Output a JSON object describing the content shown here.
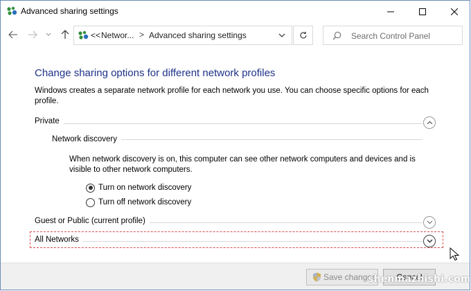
{
  "window": {
    "title": "Advanced sharing settings",
    "icon": "network-sharing-icon"
  },
  "address": {
    "prefix": "<<",
    "segments": [
      "Networ...",
      "Advanced sharing settings"
    ],
    "separator": ">"
  },
  "search": {
    "placeholder": "Search Control Panel"
  },
  "content": {
    "heading": "Change sharing options for different network profiles",
    "description": "Windows creates a separate network profile for each network you use. You can choose specific options for each profile.",
    "profiles": {
      "private": {
        "label": "Private",
        "expanded": true
      },
      "guest_public": {
        "label": "Guest or Public (current profile)",
        "expanded": false
      },
      "all_networks": {
        "label": "All Networks",
        "expanded": false,
        "focused": true
      }
    },
    "network_discovery": {
      "label": "Network discovery",
      "description": "When network discovery is on, this computer can see other network computers and devices and is visible to other network computers.",
      "options": [
        {
          "label": "Turn on network discovery",
          "checked": true
        },
        {
          "label": "Turn off network discovery",
          "checked": false
        }
      ]
    }
  },
  "footer": {
    "save_label": "Save changes",
    "cancel_label": "Cancel"
  },
  "watermark": "shenmazhishi.com",
  "colors": {
    "heading": "#1e3287",
    "focus_border": "#d94c4c",
    "window_border": "#6d8bb5"
  }
}
